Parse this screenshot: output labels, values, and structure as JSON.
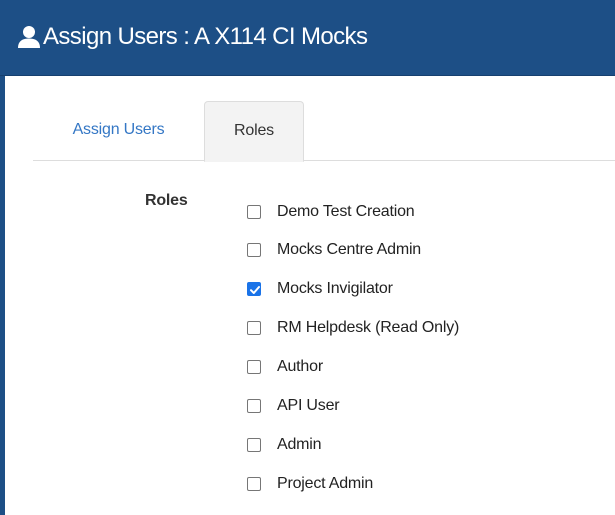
{
  "header": {
    "title": "Assign Users : A X114 CI Mocks",
    "icon": "user-icon",
    "background": "#1d4f86"
  },
  "tabs": [
    {
      "label": "Assign Users",
      "active": false
    },
    {
      "label": "Roles",
      "active": true
    }
  ],
  "roles": {
    "label": "Roles",
    "items": [
      {
        "label": "Demo Test Creation",
        "checked": false
      },
      {
        "label": "Mocks Centre Admin",
        "checked": false
      },
      {
        "label": "Mocks Invigilator",
        "checked": true
      },
      {
        "label": "RM Helpdesk (Read Only)",
        "checked": false
      },
      {
        "label": "Author",
        "checked": false
      },
      {
        "label": "API User",
        "checked": false
      },
      {
        "label": "Admin",
        "checked": false
      },
      {
        "label": "Project Admin",
        "checked": false
      }
    ]
  },
  "colors": {
    "link": "#3477c5",
    "checkbox_checked": "#1a73e8"
  }
}
